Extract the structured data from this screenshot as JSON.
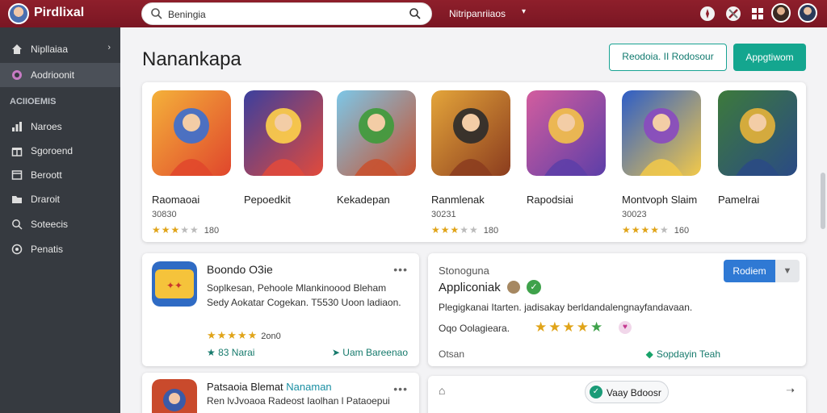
{
  "app": {
    "brand": "Pirdlixal"
  },
  "search": {
    "value": "Beningia"
  },
  "topbar": {
    "menu_label": "Nitripanriiaos",
    "icons": [
      "compass-icon",
      "tools-icon",
      "grid-icon",
      "avatar",
      "avatar"
    ]
  },
  "sidebar": {
    "items": [
      {
        "label": "Nipllaiaa",
        "icon": "home-icon"
      },
      {
        "label": "Aodrioonit",
        "icon": "gamepad-icon"
      }
    ],
    "section_title": "ACIIOEMIS",
    "section_items": [
      {
        "label": "Naroes",
        "icon": "chart-icon"
      },
      {
        "label": "Sgoroend",
        "icon": "gift-icon"
      },
      {
        "label": "Beroott",
        "icon": "window-icon"
      },
      {
        "label": "Draroit",
        "icon": "folder-icon"
      },
      {
        "label": "Soteecis",
        "icon": "search-icon"
      },
      {
        "label": "Penatis",
        "icon": "settings-icon"
      }
    ]
  },
  "page": {
    "title": "Nanankapa",
    "btn_secondary": "Reodoia. II Rodosour",
    "btn_primary": "Appgtiwom"
  },
  "games": [
    {
      "name": "Raomaoai",
      "sub": "30830",
      "rating": 3,
      "count": "180",
      "colors": [
        "#f4b13a",
        "#e0462c",
        "#3b6fd0"
      ]
    },
    {
      "name": "Pepoedkit",
      "sub": "",
      "rating": 0,
      "count": "",
      "colors": [
        "#3b3f9e",
        "#e24a3b",
        "#ffd24a"
      ]
    },
    {
      "name": "Kekadepan",
      "sub": "",
      "rating": 0,
      "count": "",
      "colors": [
        "#7cc7e8",
        "#c9502d",
        "#3e9b3a"
      ]
    },
    {
      "name": "Ranmlenak",
      "sub": "30231",
      "rating": 3,
      "count": "180",
      "colors": [
        "#e4a53a",
        "#8b3c1e",
        "#2b2b2b"
      ]
    },
    {
      "name": "Rapodsiai",
      "sub": "",
      "rating": 0,
      "count": "",
      "colors": [
        "#d35d9e",
        "#5c3ea8",
        "#f3c24a"
      ]
    },
    {
      "name": "Montvoph Slaim",
      "sub": "30023",
      "rating": 4,
      "count": "160",
      "colors": [
        "#2d5dc7",
        "#f2c94a",
        "#8a49c0"
      ]
    },
    {
      "name": "Pamelrai",
      "sub": "",
      "rating": 0,
      "count": "",
      "colors": [
        "#3d7a3b",
        "#2a4a85",
        "#e6b33a"
      ]
    }
  ],
  "app_card": {
    "title": "Boondo  O3ie",
    "desc": "Soplkesan, Pehoole Mlankinoood Bleham Sedy Aokatar Cogekan.   T5530 Uoon ladiaon.",
    "rating_count": "2on0",
    "foot_left": "83 Narai",
    "foot_right": "Uam Bareenao"
  },
  "detail_card": {
    "label": "Stonoguna",
    "title": "Appliconiak",
    "desc": "Plegigkanai Itarten. jadisakay berldandalengnayfandavaan.",
    "meta": "Oqo Oolagieara.",
    "foot_left": "Otsan",
    "foot_right": "Sopdayin Teah",
    "btn": "Rodiem"
  },
  "app_card2": {
    "title_a": "Patsaoia Blemat",
    "title_b": "Nanaman",
    "desc": "Ren lvJvoaoa Radeost Iaolhan l Pataoepui"
  },
  "bottom_card": {
    "pill": "Vaay Bdoosr"
  }
}
